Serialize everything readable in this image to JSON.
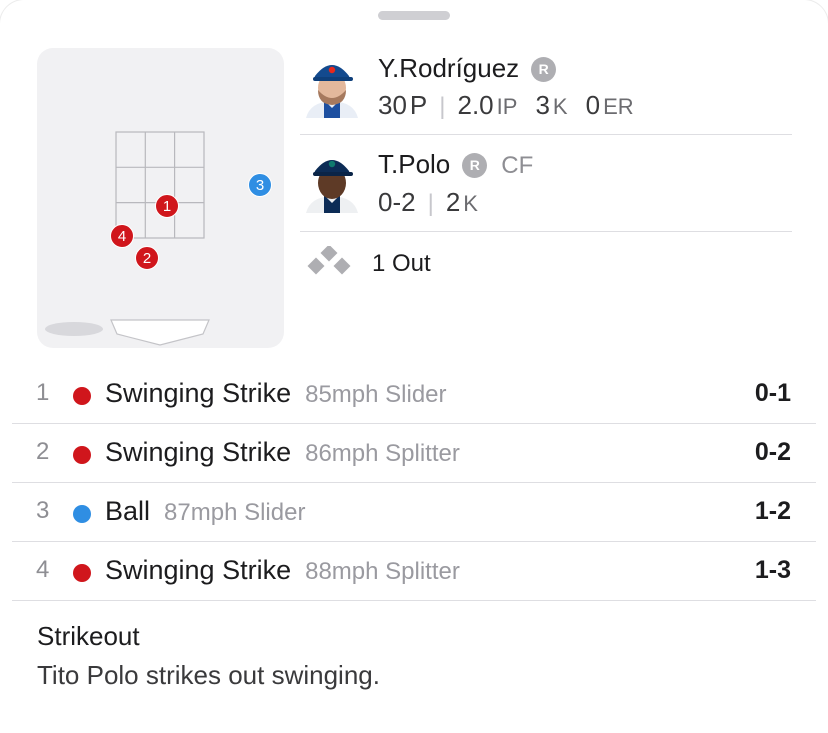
{
  "pitcher": {
    "name": "Y.Rodríguez",
    "badge": "R",
    "pitches": "30",
    "pitches_unit": "P",
    "innings": "2.0",
    "innings_unit": "IP",
    "strikeouts": "3",
    "strikeouts_unit": "K",
    "earned_runs": "0",
    "earned_runs_unit": "ER"
  },
  "batter": {
    "name": "T.Polo",
    "badge": "R",
    "position": "CF",
    "record": "0-2",
    "strikeouts": "2",
    "strikeouts_unit": "K"
  },
  "situation": {
    "outs": "1 Out"
  },
  "zone_dots": [
    {
      "label": "1",
      "type": "strike"
    },
    {
      "label": "2",
      "type": "strike"
    },
    {
      "label": "3",
      "type": "ball"
    },
    {
      "label": "4",
      "type": "strike"
    }
  ],
  "pitches": [
    {
      "num": "1",
      "type": "strike",
      "result": "Swinging Strike",
      "detail": "85mph Slider",
      "count": "0-1"
    },
    {
      "num": "2",
      "type": "strike",
      "result": "Swinging Strike",
      "detail": "86mph Splitter",
      "count": "0-2"
    },
    {
      "num": "3",
      "type": "ball",
      "result": "Ball",
      "detail": "87mph Slider",
      "count": "1-2"
    },
    {
      "num": "4",
      "type": "strike",
      "result": "Swinging Strike",
      "detail": "88mph Splitter",
      "count": "1-3"
    }
  ],
  "result": {
    "title": "Strikeout",
    "description": "Tito Polo strikes out swinging."
  },
  "colors": {
    "strike": "#d0161c",
    "ball": "#2f8ee3"
  }
}
